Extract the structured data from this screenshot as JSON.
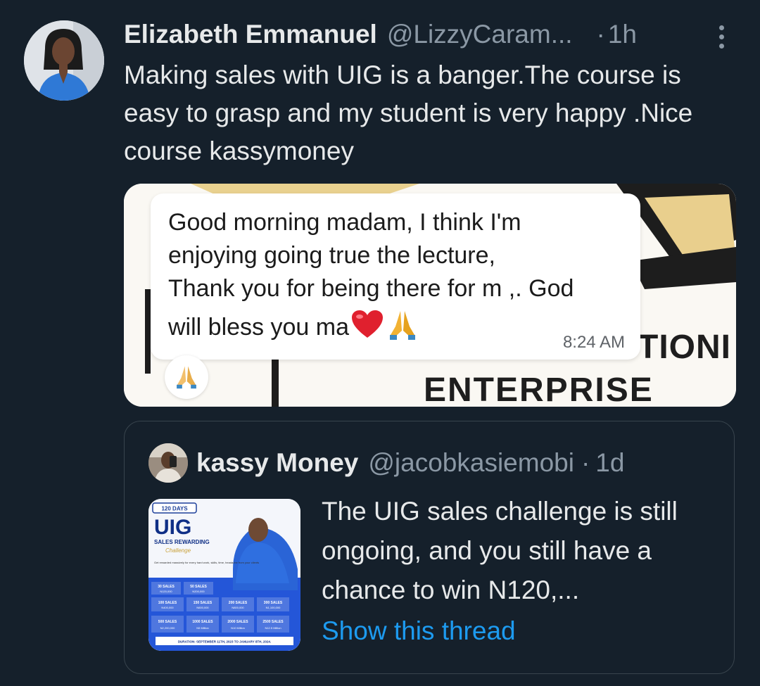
{
  "tweet": {
    "display_name": "Elizabeth Emmanuel",
    "handle": "@LizzyCaram...",
    "separator": "·",
    "time": "1h",
    "text": "Making sales with UIG is a banger.The course is easy to grasp and my student is very happy .Nice course kassymoney"
  },
  "media": {
    "message_lines": [
      "Good morning madam, I think I'm",
      "enjoying going true the lecture,",
      "Thank you for being there for m ,. God",
      "will bless you ma"
    ],
    "message_time": "8:24 AM",
    "background_word_1": "TIONI",
    "background_word_2": "ENTERPRISE"
  },
  "quote": {
    "display_name": "kassy Money",
    "handle": "@jacobkasiemobi",
    "separator": "·",
    "time": "1d",
    "text": "The UIG sales challenge is still ongoing, and you still have a chance to win N120,...",
    "link_label": "Show this thread",
    "thumbnail": {
      "badge": "120 DAYS",
      "title": "UIG",
      "subtitle": "SALES REWARDING",
      "script": "Challenge",
      "blurb": "Get rewarded massively for every hard work, skills, time, headache from your clients",
      "tiers": [
        {
          "sales": "30 SALES",
          "reward": "N120,000"
        },
        {
          "sales": "50 SALES",
          "reward": "N200,000"
        },
        {
          "sales": "100 SALES",
          "reward": "N400,000"
        },
        {
          "sales": "150 SALES",
          "reward": "N600,000"
        },
        {
          "sales": "200 SALES",
          "reward": "N800,000"
        },
        {
          "sales": "300 SALES",
          "reward": "N1,100,000"
        },
        {
          "sales": "500 SALES",
          "reward": "N2,200,000"
        },
        {
          "sales": "1000 SALES",
          "reward": "N5 Million"
        },
        {
          "sales": "2000 SALES",
          "reward": "N10 Million"
        },
        {
          "sales": "2500 SALES",
          "reward": "N12.5 Million"
        }
      ],
      "duration": "DURATION: SEPTEMBER 11TH, 2023 TO JANUARY 8TH, 2024."
    }
  },
  "icons": {
    "more": "more-vertical-icon",
    "heart": "heart-emoji-icon",
    "pray": "folded-hands-emoji-icon"
  },
  "colors": {
    "background": "#15202b",
    "text": "#e7e9ea",
    "muted": "#8b98a5",
    "link": "#1d9bf0",
    "border": "#38444d"
  }
}
